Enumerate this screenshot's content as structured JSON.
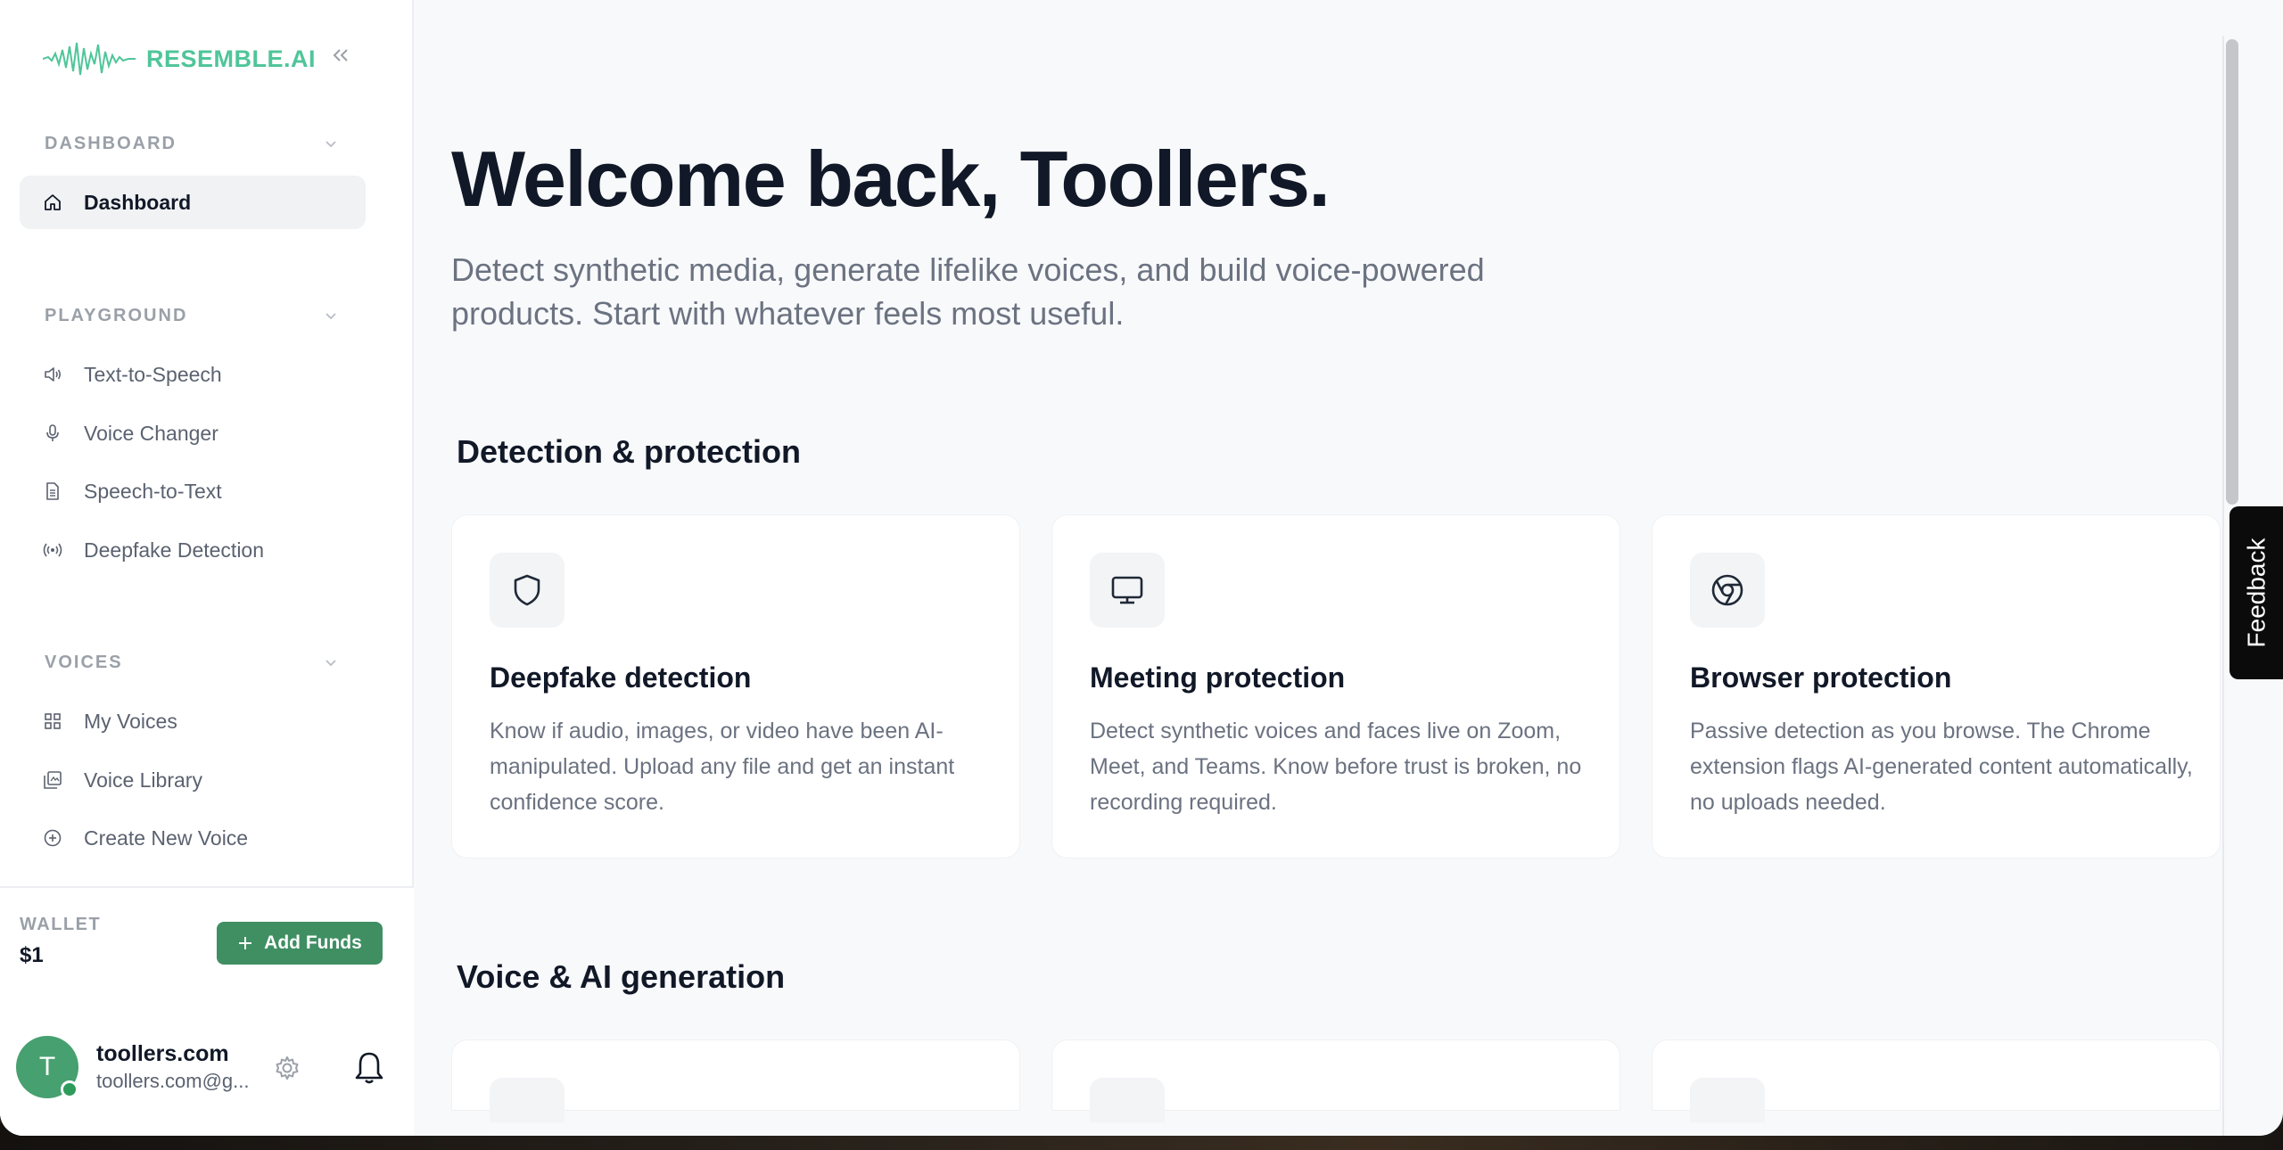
{
  "app": {
    "logo_text": "RESEMBLE.AI"
  },
  "sidebar": {
    "sections": [
      {
        "title": "DASHBOARD"
      },
      {
        "title": "PLAYGROUND"
      },
      {
        "title": "VOICES"
      }
    ],
    "items": [
      {
        "label": "Dashboard",
        "icon": "home-icon",
        "active": true
      },
      {
        "label": "Text-to-Speech",
        "icon": "speaker-icon"
      },
      {
        "label": "Voice Changer",
        "icon": "microphone-icon"
      },
      {
        "label": "Speech-to-Text",
        "icon": "document-icon"
      },
      {
        "label": "Deepfake Detection",
        "icon": "broadcast-icon"
      },
      {
        "label": "My Voices",
        "icon": "grid-icon"
      },
      {
        "label": "Voice Library",
        "icon": "library-icon"
      },
      {
        "label": "Create New Voice",
        "icon": "plus-circle-icon"
      }
    ],
    "wallet": {
      "label": "WALLET",
      "amount": "$1",
      "add_funds_label": "Add Funds"
    },
    "user": {
      "initial": "T",
      "name": "toollers.com",
      "email": "toollers.com@g..."
    }
  },
  "main": {
    "welcome": "Welcome back, Toollers.",
    "subtitle": "Detect synthetic media, generate lifelike voices, and build voice-powered products. Start with whatever feels most useful.",
    "sections": [
      {
        "title": "Detection & protection",
        "cards": [
          {
            "title": "Deepfake detection",
            "icon": "shield-icon",
            "desc": "Know if audio, images, or video have been AI-manipulated. Upload any file and get an instant confidence score."
          },
          {
            "title": "Meeting protection",
            "icon": "monitor-icon",
            "desc": "Detect synthetic voices and faces live on Zoom, Meet, and Teams. Know before trust is broken, no recording required."
          },
          {
            "title": "Browser protection",
            "icon": "chrome-icon",
            "desc": "Passive detection as you browse. The Chrome extension flags AI-generated content automatically, no uploads needed."
          }
        ]
      },
      {
        "title": "Voice & AI generation"
      }
    ]
  },
  "feedback_label": "Feedback",
  "colors": {
    "accent": "#3f8f63",
    "logo": "#4fc59a"
  }
}
